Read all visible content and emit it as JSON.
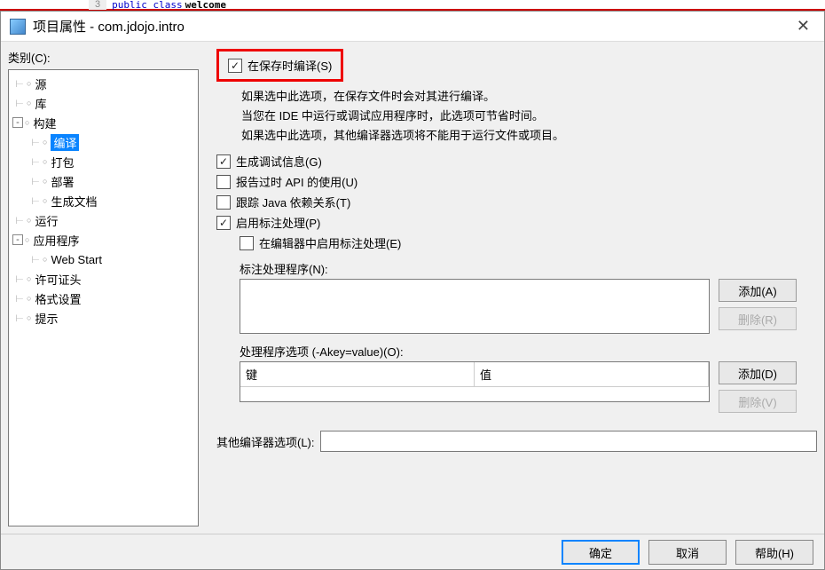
{
  "background": {
    "line_num": "3",
    "code_keyword": "public class",
    "code_name": "welcome"
  },
  "dialog": {
    "title": "项目属性 - com.jdojo.intro",
    "category_label": "类别(C):"
  },
  "tree": {
    "items": [
      {
        "label": "源",
        "level": 1,
        "bullet": true
      },
      {
        "label": "库",
        "level": 1,
        "bullet": true
      },
      {
        "label": "构建",
        "level": 1,
        "expand": "-"
      },
      {
        "label": "编译",
        "level": 2,
        "bullet": true,
        "selected": true
      },
      {
        "label": "打包",
        "level": 2,
        "bullet": true
      },
      {
        "label": "部署",
        "level": 2,
        "bullet": true
      },
      {
        "label": "生成文档",
        "level": 2,
        "bullet": true
      },
      {
        "label": "运行",
        "level": 1,
        "bullet": true
      },
      {
        "label": "应用程序",
        "level": 1,
        "expand": "-"
      },
      {
        "label": "Web Start",
        "level": 2,
        "bullet": true
      },
      {
        "label": "许可证头",
        "level": 1,
        "bullet": true
      },
      {
        "label": "格式设置",
        "level": 1,
        "bullet": true
      },
      {
        "label": "提示",
        "level": 1,
        "bullet": true
      }
    ]
  },
  "main": {
    "compile_on_save": "在保存时编译(S)",
    "desc1": "如果选中此选项，在保存文件时会对其进行编译。",
    "desc2": "当您在 IDE 中运行或调试应用程序时，此选项可节省时间。",
    "desc3": "如果选中此选项，其他编译器选项将不能用于运行文件或项目。",
    "gen_debug": "生成调试信息(G)",
    "report_deprecated": "报告过时 API 的使用(U)",
    "track_deps": "跟踪 Java 依赖关系(T)",
    "enable_anno": "启用标注处理(P)",
    "enable_anno_editor": "在编辑器中启用标注处理(E)",
    "anno_processors_label": "标注处理程序(N):",
    "processor_options_label": "处理程序选项 (-Akey=value)(O):",
    "table_key": "键",
    "table_value": "值",
    "other_options_label": "其他编译器选项(L):",
    "other_options_value": "",
    "add_a": "添加(A)",
    "del_r": "删除(R)",
    "add_d": "添加(D)",
    "del_v": "删除(V)"
  },
  "footer": {
    "ok": "确定",
    "cancel": "取消",
    "help": "帮助(H)"
  }
}
